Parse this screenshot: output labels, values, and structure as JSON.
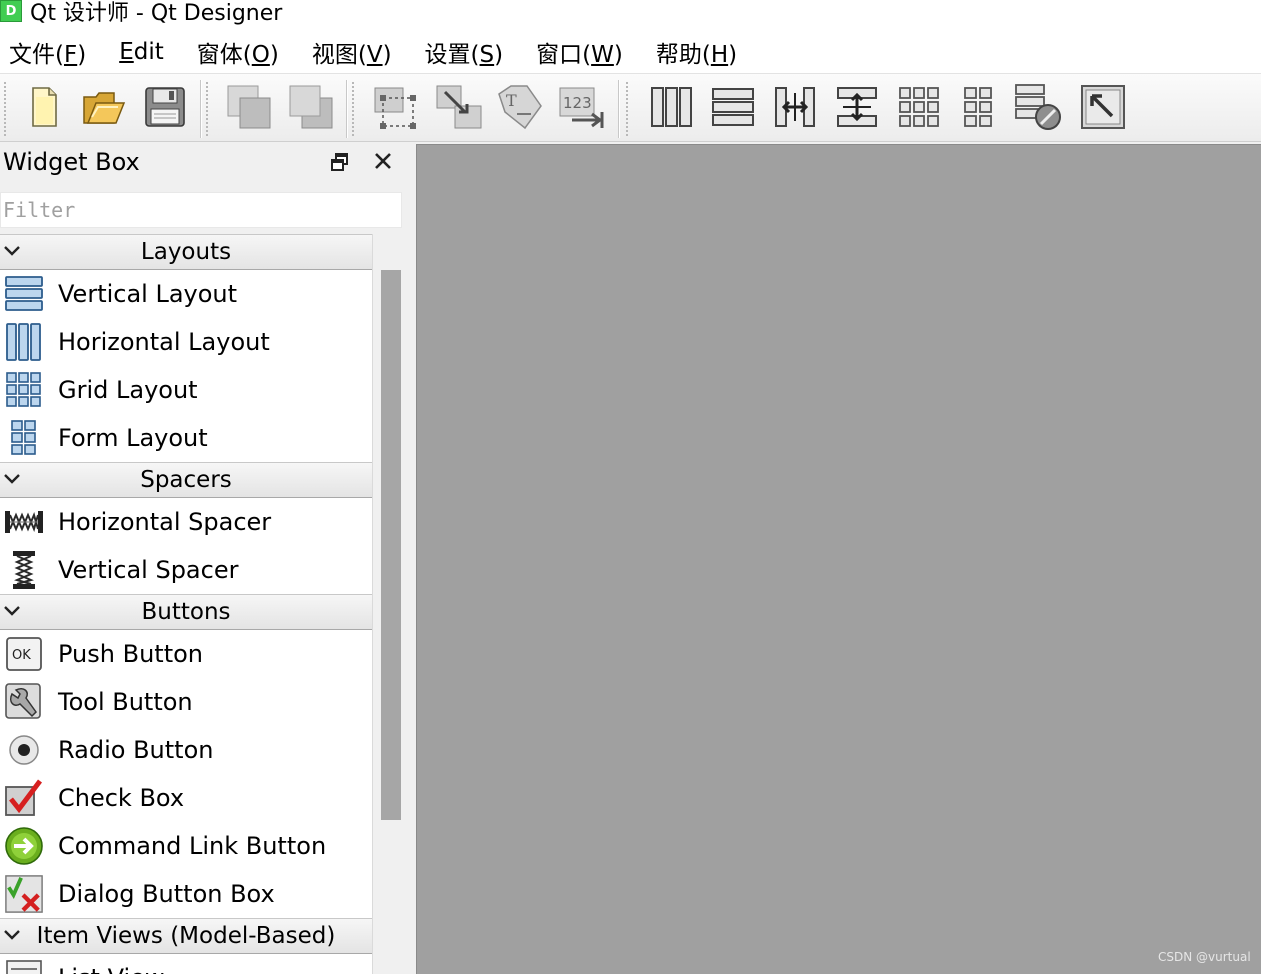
{
  "window": {
    "app_icon_letter": "D",
    "title": "Qt 设计师 - Qt Designer"
  },
  "menubar": [
    {
      "pre": "文件(",
      "key": "F",
      "post": ")"
    },
    {
      "pre": "",
      "key": "E",
      "post": "dit"
    },
    {
      "pre": "窗体(",
      "key": "O",
      "post": ")"
    },
    {
      "pre": "视图(",
      "key": "V",
      "post": ")"
    },
    {
      "pre": "设置(",
      "key": "S",
      "post": ")"
    },
    {
      "pre": "窗口(",
      "key": "W",
      "post": ")"
    },
    {
      "pre": "帮助(",
      "key": "H",
      "post": ")"
    }
  ],
  "toolbar": {
    "icons": [
      "new-file-icon",
      "open-folder-icon",
      "save-icon",
      "send-to-back-icon",
      "bring-to-front-icon",
      "edit-widgets-icon",
      "edit-signals-slots-icon",
      "edit-buddies-icon",
      "edit-tab-order-icon",
      "lay-out-horizontally-icon",
      "lay-out-vertically-icon",
      "horizontal-splitter-icon",
      "vertical-splitter-icon",
      "lay-out-grid-icon",
      "lay-out-form-icon",
      "break-layout-icon",
      "adjust-size-icon"
    ]
  },
  "widget_box": {
    "title": "Widget Box",
    "filter_placeholder": "Filter",
    "categories": [
      {
        "label": "Layouts",
        "items": [
          {
            "label": "Vertical Layout",
            "icon": "vertical-layout-icon"
          },
          {
            "label": "Horizontal Layout",
            "icon": "horizontal-layout-icon"
          },
          {
            "label": "Grid Layout",
            "icon": "grid-layout-icon"
          },
          {
            "label": "Form Layout",
            "icon": "form-layout-icon"
          }
        ]
      },
      {
        "label": "Spacers",
        "items": [
          {
            "label": "Horizontal Spacer",
            "icon": "horizontal-spacer-icon"
          },
          {
            "label": "Vertical Spacer",
            "icon": "vertical-spacer-icon"
          }
        ]
      },
      {
        "label": "Buttons",
        "items": [
          {
            "label": "Push Button",
            "icon": "push-button-icon"
          },
          {
            "label": "Tool Button",
            "icon": "tool-button-icon"
          },
          {
            "label": "Radio Button",
            "icon": "radio-button-icon"
          },
          {
            "label": "Check Box",
            "icon": "check-box-icon"
          },
          {
            "label": "Command Link Button",
            "icon": "command-link-button-icon"
          },
          {
            "label": "Dialog Button Box",
            "icon": "dialog-button-box-icon"
          }
        ]
      },
      {
        "label": "Item Views (Model-Based)",
        "items": [
          {
            "label": "List View",
            "icon": "list-view-icon"
          }
        ]
      }
    ]
  },
  "watermark": "CSDN @vurtual",
  "colors": {
    "mdi_background": "#a0a0a0",
    "category_header": "#e4e4e4",
    "scroll_thumb": "#a6a6a6"
  }
}
